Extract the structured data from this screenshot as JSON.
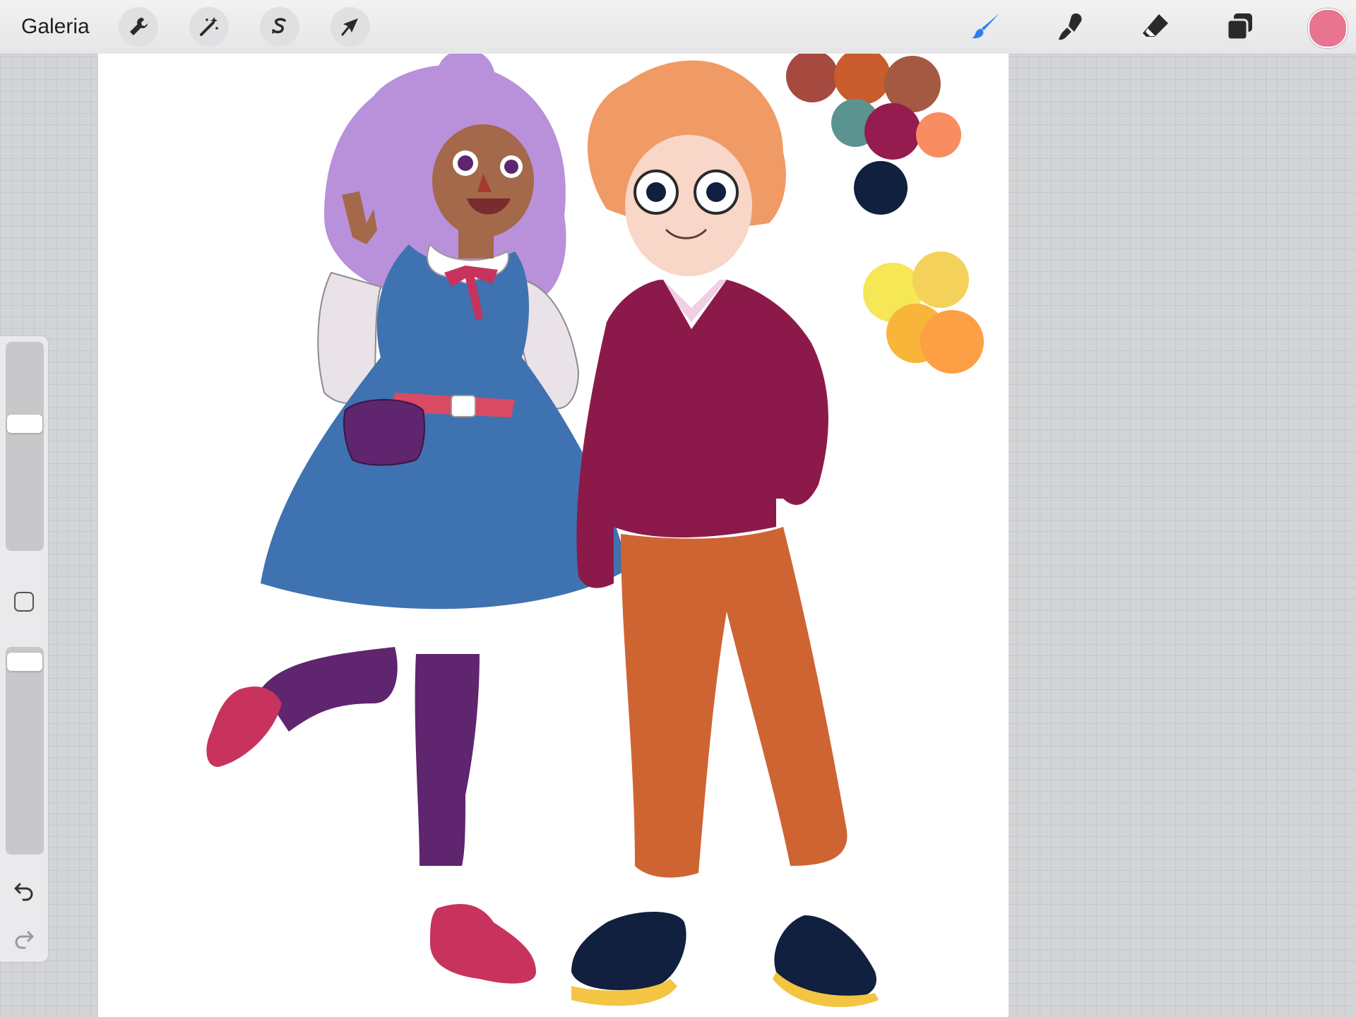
{
  "header": {
    "gallery_label": "Galeria",
    "left_tools": [
      "wrench-icon",
      "magic-wand-icon",
      "selection-icon",
      "transform-arrow-icon"
    ],
    "right_tools": [
      "brush-icon",
      "smudge-icon",
      "eraser-icon",
      "layers-icon"
    ],
    "active_tool": "brush",
    "active_tool_color": "#2d7ef0",
    "current_color": "#e8748f"
  },
  "sidebar": {
    "brush_size_level": 0.62,
    "opacity_level": 0.97,
    "icons": [
      "modifier-square-icon",
      "undo-icon",
      "redo-icon"
    ]
  },
  "canvas": {
    "background": "#ffffff",
    "palette_swatches": [
      "#a6493f",
      "#c85c2c",
      "#a45a42",
      "#5b9391",
      "#951c4e",
      "#f98c60",
      "#10203e",
      "#f5e756",
      "#f4d259",
      "#f8b539",
      "#fd9f44"
    ],
    "character_colors": {
      "hair_left": "#b990da",
      "dress": "#3f72b0",
      "tights": "#5f256e",
      "shoes": "#c7335d",
      "sweater": "#8b1a4a",
      "pants": "#cf6433",
      "hair_right": "#f09a66",
      "skin_dark": "#a4684a",
      "skin_light": "#f8d6c8"
    }
  }
}
